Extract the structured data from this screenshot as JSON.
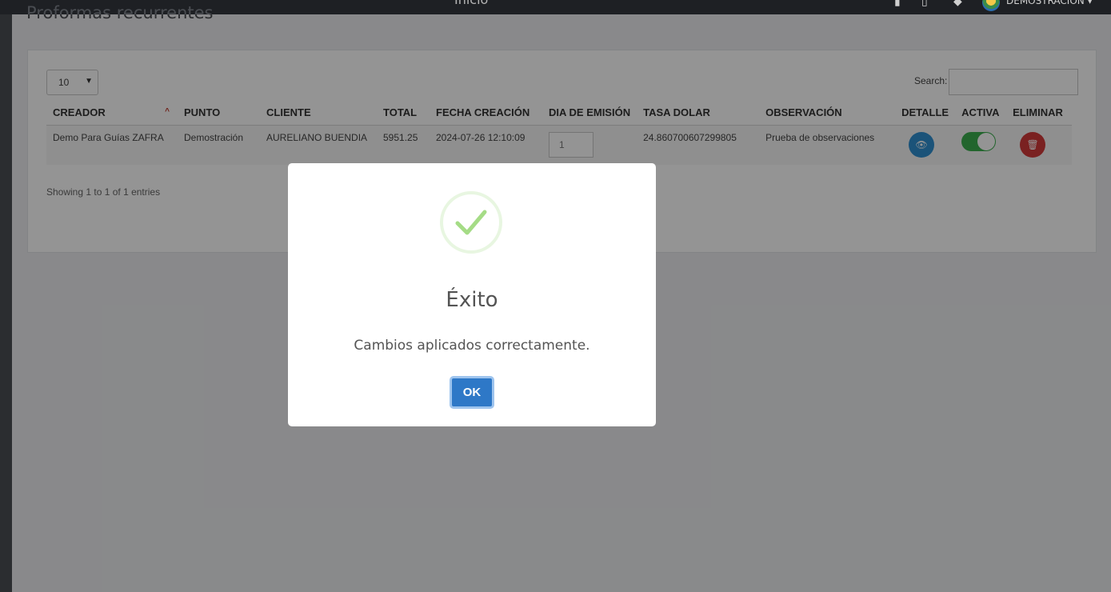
{
  "app": {
    "header_title": "Inicio",
    "user_name": "DEMOSTRACIÓN"
  },
  "page": {
    "title": "Proformas recurrentes"
  },
  "table_controls": {
    "page_length": "10",
    "search_label": "Search:",
    "search_value": ""
  },
  "table": {
    "columns": [
      "CREADOR",
      "PUNTO",
      "CLIENTE",
      "TOTAL",
      "FECHA CREACIÓN",
      "DIA DE EMISIÓN",
      "TASA DOLAR",
      "OBSERVACIÓN",
      "DETALLE",
      "ACTIVA",
      "ELIMINAR"
    ],
    "rows": [
      {
        "creador": "Demo Para Guías ZAFRA",
        "punto": "Demostración",
        "cliente": "AURELIANO BUENDIA",
        "total": "5951.25",
        "fecha_creacion": "2024-07-26 12:10:09",
        "dia_emision": "1",
        "tasa_dolar": "24.860700607299805",
        "observacion": "Prueba de observaciones",
        "activa": true
      }
    ],
    "info": "Showing 1 to 1 of 1 entries"
  },
  "modal": {
    "icon": "success-check-icon",
    "title": "Éxito",
    "message": "Cambios aplicados correctamente.",
    "ok_label": "OK"
  },
  "colors": {
    "success_green": "#a5dc86",
    "ok_button": "#2e78c7",
    "toggle_on": "#3cae4f",
    "view_button": "#2f8fd1",
    "delete_button": "#d23a3a"
  }
}
